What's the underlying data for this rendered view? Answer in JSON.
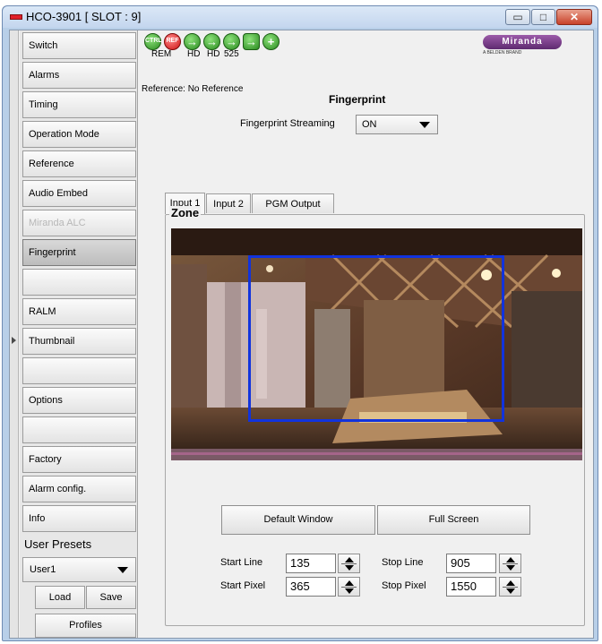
{
  "window": {
    "title": "HCO-3901 [ SLOT : 9]",
    "controls": {
      "minimize": "▭",
      "maximize": "□",
      "close": "✕"
    }
  },
  "sidebar": {
    "items": [
      {
        "label": "Switch",
        "state": "normal"
      },
      {
        "label": "Alarms",
        "state": "normal"
      },
      {
        "label": "Timing",
        "state": "normal"
      },
      {
        "label": "Operation Mode",
        "state": "normal"
      },
      {
        "label": "Reference",
        "state": "normal"
      },
      {
        "label": "Audio Embed",
        "state": "normal"
      },
      {
        "label": "Miranda ALC",
        "state": "disabled"
      },
      {
        "label": "Fingerprint",
        "state": "active"
      },
      {
        "label": "",
        "state": "normal"
      },
      {
        "label": "RALM",
        "state": "normal"
      },
      {
        "label": "Thumbnail",
        "state": "normal"
      },
      {
        "label": "",
        "state": "normal"
      },
      {
        "label": "Options",
        "state": "normal"
      },
      {
        "label": "",
        "state": "normal"
      },
      {
        "label": "Factory",
        "state": "normal"
      },
      {
        "label": "Alarm config.",
        "state": "normal"
      },
      {
        "label": "Info",
        "state": "normal"
      }
    ],
    "presets_label": "User Presets",
    "preset_value": "User1",
    "load_label": "Load",
    "save_label": "Save",
    "profiles_label": "Profiles"
  },
  "status": {
    "icons": [
      "ctrl-icon",
      "ref-icon",
      "arrow-ok-icon",
      "arrow-ok-icon",
      "arrow-ok-icon",
      "arrow-ok-icon",
      "plus-icon"
    ],
    "ctrl_text": "CTRL",
    "ref_text": "REF",
    "labels": [
      "REM",
      "HD",
      "HD",
      "525"
    ]
  },
  "brand": {
    "name": "Miranda",
    "sub": "A BELDEN BRAND"
  },
  "reference_text": "Reference: No Reference",
  "page_title": "Fingerprint",
  "streaming": {
    "label": "Fingerprint Streaming",
    "value": "ON"
  },
  "tabs": [
    "Input 1",
    "Input 2",
    "PGM Output"
  ],
  "zone_title": "Zone",
  "buttons": {
    "default_window": "Default Window",
    "full_screen": "Full Screen"
  },
  "fields": {
    "start_line": {
      "label": "Start Line",
      "value": "135"
    },
    "stop_line": {
      "label": "Stop Line",
      "value": "905"
    },
    "start_pixel": {
      "label": "Start Pixel",
      "value": "365"
    },
    "stop_pixel": {
      "label": "Stop Pixel",
      "value": "1550"
    }
  },
  "colors": {
    "zone_rect": "#1133dd",
    "brand": "#7a3f8c"
  }
}
